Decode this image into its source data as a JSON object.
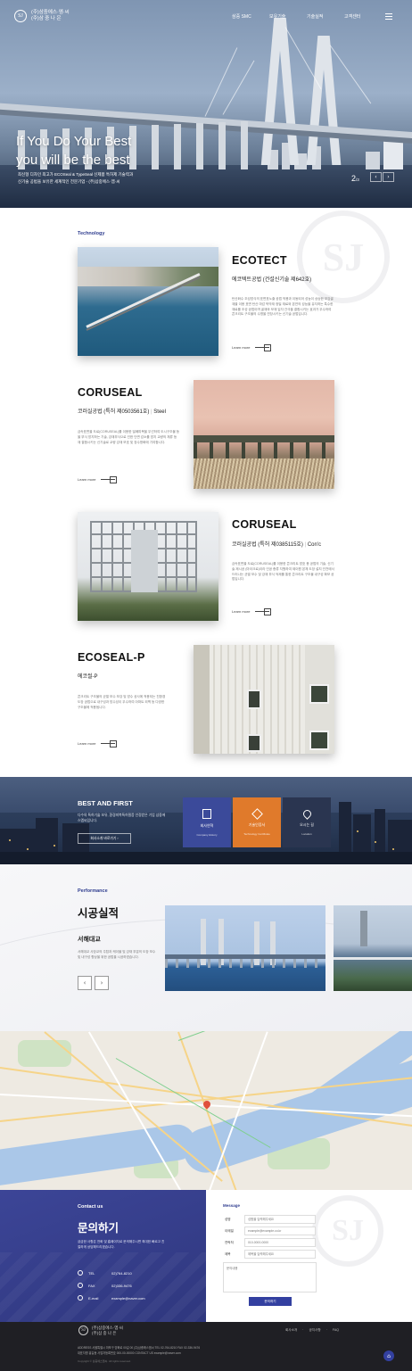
{
  "header": {
    "logo_mark": "SJ",
    "logo_line1": "(주)삼중에스·엠·씨",
    "logo_line2": "(주)삼 중 나 은",
    "nav": [
      "삼중 SMC",
      "보유기술",
      "기술실적",
      "고객센터"
    ],
    "menu_icon": "hamburger-icon"
  },
  "hero": {
    "title_line1": "If You Do Your Best",
    "title_line2": "you will be the best",
    "sub_line1": "최신형 디자인 최고가 ECOSeal & TypeSeal 신제품 특허제 기술력과",
    "sub_line2": "신기술 공법을 보유한 세계적인 전문기업 - (주)삼중에스·엠·씨",
    "page_current": "2",
    "page_total": "/3",
    "prev": "‹",
    "next": "›"
  },
  "technology": {
    "label": "Technology",
    "items": [
      {
        "title": "ECOTECT",
        "subtitle": "에코텍트공법 (건설신기술 제642호)",
        "desc": "탄산화수 조성방식의 표면표노출 공법 적용과 이동되어 성능이 상승한 보강골재을 이용 표면 탄산 마감 박막재 정밀 재료와 본연의 성능을 유지하는 특수한 재료를 조성 공법이며 골재와 모재 입자 간극을 결합시키는 효과가 우수하여 콘크리트 구조물의 수명을 연장시키는 신기술 공법입니다.",
        "learn": "Learn more"
      },
      {
        "title": "CORUSEAL",
        "subtitle_main": "코러실공법 (특허 제0503561호)",
        "subtitle_tag": "Steel",
        "desc": "금속표면을 도료(CORUSEAL)를 이용한 밀폐피복을 우선하여 도시구조물 등을 부식 방지하는 기술, 강재부식으로 인한 단면 감소를 방지 교량의 체류 등 재 결합시키는 신기술로 교량 강재 보호 및 장수명화에 기여합니다.",
        "learn": "Learn more"
      },
      {
        "title": "CORUSEAL",
        "subtitle_main": "코러실공법 (특허 제0385115호)",
        "subtitle_tag": "Con'c",
        "desc": "금속표면을 도료(CORUSEAL)를 이용한 콘크리트 방호 용 공법의 기술, 신기술 제시공 (마이크로)이라 인공 증류 지원하여 제이원 본체 도장 설치 인천에서 드러나는 균열 보수 및 강재 부식 억제를 통한 콘크리트 구조물 내구성 확보 공법입니다.",
        "learn": "Learn more"
      },
      {
        "title": "ECOSEAL-P",
        "subtitle": "에코씰-P",
        "desc": "콘크리트 구조물의 균열 보수 보강 및 방수 공사에 적용되는 친환경 도장 공법으로 내구성과 방수성이 우수하여 아파트 외벽 등 다양한 구조물에 적용됩니다.",
        "learn": "Learn more"
      }
    ]
  },
  "best": {
    "title": "BEST AND FIRST",
    "desc": "다수의 특허기술 보유, 환경피복특허필증 인정받은 기업 삼중에스엠씨입니다.",
    "button": "회사소개 바로가기",
    "boxes": [
      {
        "title": "회사연혁",
        "sub": "Company History",
        "icon": "document-icon",
        "color": "#3b4a9a"
      },
      {
        "title": "기술인증서",
        "sub": "Technology Certificate",
        "icon": "layers-icon",
        "color": "#e07a2b"
      },
      {
        "title": "오시는 길",
        "sub": "Location",
        "icon": "map-pin-icon",
        "color": "#2a3550"
      }
    ]
  },
  "performance": {
    "label": "Performance",
    "title": "시공실적",
    "project": "서해대교",
    "desc": "서해대교 사장교의 주탑과 케이블 및 강재 부분의 도장 보수 및 내구성 향상을 위한 공법을 시공하였습니다.",
    "prev": "‹",
    "next": "›"
  },
  "contact": {
    "label": "Contact us",
    "title": "문의하기",
    "desc": "궁금한 사항은 전화 및 홈페이지로 문의해주시면 최대한 빠르고 친절하게 상담해드리겠습니다.",
    "rows": [
      {
        "icon": "phone-icon",
        "key": "TEL",
        "value": "02)764-8210"
      },
      {
        "icon": "fax-icon",
        "key": "FAX",
        "value": "02)336-9476"
      },
      {
        "icon": "mail-icon",
        "key": "E-mail",
        "value": "example@naver.com"
      }
    ]
  },
  "form": {
    "label": "Message",
    "fields": [
      {
        "key": "성명",
        "placeholder": "성함을 입력해주세요"
      },
      {
        "key": "이메일",
        "placeholder": "example@example.co.kr"
      },
      {
        "key": "연락처",
        "placeholder": "010-0000-0000"
      },
      {
        "key": "제목",
        "placeholder": "제목을 입력해주세요"
      }
    ],
    "message_placeholder": "문의내용",
    "submit": "문의하기"
  },
  "footer": {
    "links": [
      "회사소개",
      "공지사항",
      "FAQ"
    ],
    "info1": "ADDRESS  서울특별시 마포구 양화로 00길 00 (주)삼중에스엠씨   TEL 02-764-8210   FAX 02-336-9476",
    "info2": "대표자명  홍길동   사업자등록번호  000-00-00000   CONTACT US  example@naver.com",
    "copyright": "Copyright © 삼중에스엠씨. All rights reserved.",
    "top": "⌂"
  }
}
